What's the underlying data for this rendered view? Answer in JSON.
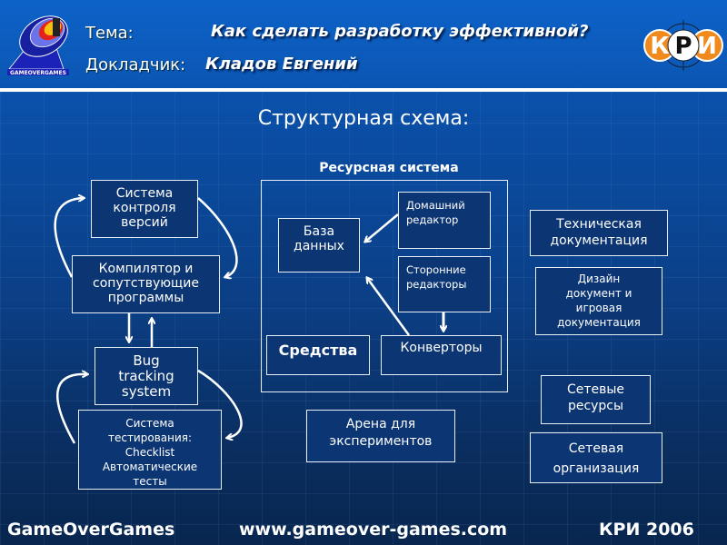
{
  "header": {
    "logo_text": "GAMEOVERGAMES",
    "topic_label": "Тема:",
    "topic_value": "Как сделать разработку эффективной?",
    "speaker_label": "Докладчик:",
    "speaker_value": "Кладов Евгений",
    "kri_logo": [
      "К",
      "Р",
      "И"
    ]
  },
  "slide": {
    "title": "Структурная схема:"
  },
  "diagram": {
    "left_chain": {
      "vcs": [
        "Система",
        "контроля",
        "версий"
      ],
      "compiler": [
        "Компилятор и",
        "сопутствующие",
        "программы"
      ],
      "bug_tracking": [
        "Bug",
        "tracking",
        "system"
      ],
      "testing": [
        "Система",
        "тестирования:",
        "Checklist",
        "Автоматические",
        "тесты"
      ]
    },
    "resource_system": {
      "title": "Ресурсная система",
      "database": [
        "База",
        "данных"
      ],
      "home_editor": [
        "Домашний",
        "редактор"
      ],
      "third_party_editors": [
        "Сторонние",
        "редакторы"
      ],
      "tools": "Средства",
      "converters": "Конверторы"
    },
    "arena": [
      "Арена для",
      "экспериментов"
    ],
    "right_column": {
      "tech_docs": [
        "Техническая",
        "документация"
      ],
      "design_docs": [
        "Дизайн",
        "документ и",
        "игровая",
        "документация"
      ],
      "network_resources": [
        "Сетевые",
        "ресурсы"
      ],
      "network_org": [
        "Сетевая",
        "организация"
      ]
    }
  },
  "footer": {
    "left": "GameOverGames",
    "center": "www.gameover-games.com",
    "right": "КРИ 2006"
  },
  "colors": {
    "header_blue": "#0b56b3",
    "box_fill": "#0b3573",
    "kri_orange": "#f08a1c"
  }
}
